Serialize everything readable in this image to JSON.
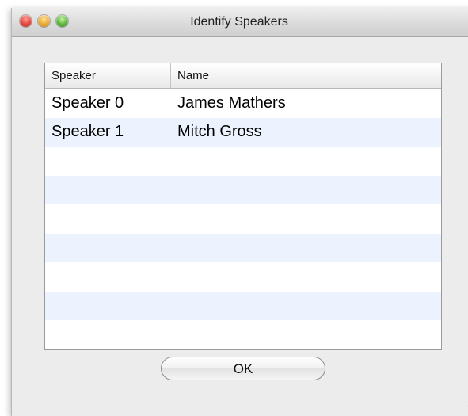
{
  "window": {
    "title": "Identify Speakers"
  },
  "table": {
    "columns": [
      "Speaker",
      "Name"
    ],
    "rows": [
      {
        "speaker": "Speaker 0",
        "name": "James Mathers"
      },
      {
        "speaker": "Speaker 1",
        "name": "Mitch Gross"
      }
    ]
  },
  "buttons": {
    "ok_label": "OK"
  },
  "colors": {
    "stripe": "#edf3fe",
    "window_bg": "#ececec"
  }
}
